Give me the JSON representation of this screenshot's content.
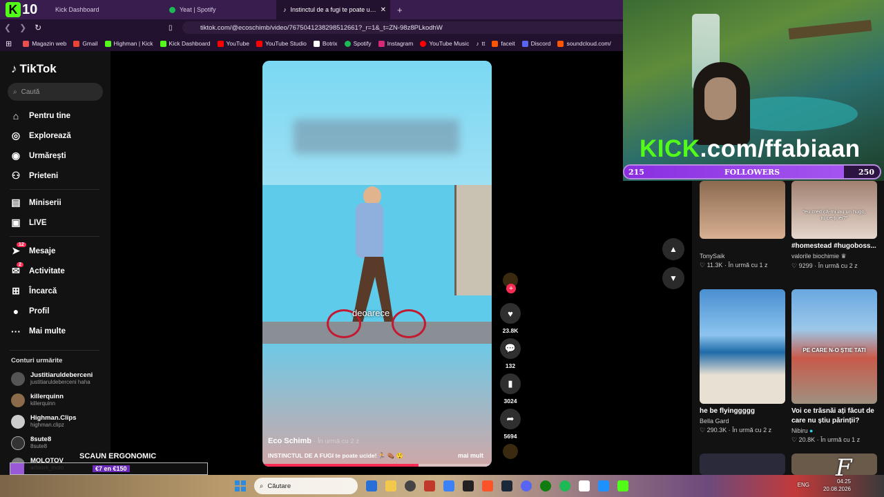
{
  "browser": {
    "tabs": [
      {
        "label": "Kick Dashboard",
        "icon": "kick-icon",
        "active": false
      },
      {
        "label": "Yeat | Spotify",
        "icon": "spotify-icon",
        "active": false
      },
      {
        "label": "Instinctul de a fugi te poate u…",
        "icon": "tiktok-icon",
        "active": true
      }
    ],
    "url": "tiktok.com/@ecoschimb/video/7675041238298512661?_r=1&_t=ZN-98z8PLkodhW",
    "bookmarks": [
      {
        "label": "Magazin web",
        "color": "#e94f4f"
      },
      {
        "label": "Gmail",
        "color": "#ea4335"
      },
      {
        "label": "Highman | Kick",
        "color": "#53fc18"
      },
      {
        "label": "Kick Dashboard",
        "color": "#53fc18"
      },
      {
        "label": "YouTube",
        "color": "#ff0000"
      },
      {
        "label": "YouTube Studio",
        "color": "#ff0000"
      },
      {
        "label": "Botrix",
        "color": "#ffffff"
      },
      {
        "label": "Spotify",
        "color": "#1db954"
      },
      {
        "label": "Instagram",
        "color": "#d62976"
      },
      {
        "label": "YouTube Music",
        "color": "#ff0000"
      },
      {
        "label": "tt",
        "color": "#ffffff"
      },
      {
        "label": "faceit",
        "color": "#ff5500"
      },
      {
        "label": "Discord",
        "color": "#5865f2"
      },
      {
        "label": "soundcloud.com/",
        "color": "#ff5500"
      }
    ]
  },
  "kick_badge": {
    "number": "10"
  },
  "tiktok": {
    "logo": "TikTok",
    "search_placeholder": "Caută",
    "menu": [
      {
        "label": "Pentru tine",
        "icon": "home-icon"
      },
      {
        "label": "Explorează",
        "icon": "compass-icon"
      },
      {
        "label": "Urmărești",
        "icon": "following-icon"
      },
      {
        "label": "Prieteni",
        "icon": "friends-icon"
      },
      {
        "label": "Miniserii",
        "icon": "series-icon"
      },
      {
        "label": "LIVE",
        "icon": "live-icon"
      },
      {
        "label": "Mesaje",
        "icon": "messages-icon",
        "badge": "12"
      },
      {
        "label": "Activitate",
        "icon": "activity-icon",
        "badge": "2"
      },
      {
        "label": "Încarcă",
        "icon": "upload-icon"
      },
      {
        "label": "Profil",
        "icon": "profile-icon"
      },
      {
        "label": "Mai multe",
        "icon": "more-icon"
      }
    ],
    "following_title": "Conturi urmărite",
    "following": [
      {
        "name": "Justitiaruldeberceni",
        "user": "justitiaruldeberceni haha"
      },
      {
        "name": "killerquinn",
        "user": "killerquinn"
      },
      {
        "name": "Highman.Clips",
        "user": "highman.clipz"
      },
      {
        "name": "8sute8",
        "user": "8sute8"
      },
      {
        "name": "MOLOTOV",
        "user": "artwork_molo"
      }
    ]
  },
  "video": {
    "caption": "deoarece",
    "author": "Eco Schimb",
    "time": "· În urmă cu 2 z",
    "description": "INSTINCTUL DE A FUGI te poate ucide! 🏃 ⚰️ 😲",
    "more": "mai mult",
    "progress": 0.68,
    "likes": "23.8K",
    "comments": "132",
    "saves": "3024",
    "shares": "5694"
  },
  "recommended": [
    {
      "title": "",
      "author": "TonySaik",
      "likes": "11.3K",
      "time": "În urmă cu 1 z",
      "overlay": ""
    },
    {
      "title": "#homestead #hugoboss...",
      "author": "valorile biochimie ♛",
      "likes": "9299",
      "time": "În urmă cu 2 z",
      "overlay": "\"eu cred că-mi iau un hugo, tu ce-ți iei?\""
    },
    {
      "title": "he be flyinggggg",
      "author": "Bella Gard",
      "likes": "290.3K",
      "time": "În urmă cu 2 z",
      "overlay": ""
    },
    {
      "title": "Voi ce trăsnăi ați făcut de care nu știu părinții?",
      "author": "Nibiru",
      "likes": "20.8K",
      "time": "În urmă cu 1 z",
      "overlay": "PE CARE N-O ȘTIE TATI"
    }
  ],
  "stream": {
    "kick_text_1": "KICK",
    "kick_text_2": ".com/ffabiaan",
    "followers_label": "FOLLOWERS",
    "followers_current": "215",
    "followers_goal": "250",
    "followers_progress": 0.86
  },
  "ad": {
    "title": "SCAUN ERGONOMIC",
    "price": "€7 en €150"
  },
  "taskbar": {
    "search": "Căutare",
    "lang": "ENG",
    "time": "04:25",
    "date": "20.08.2026"
  },
  "signature": "F"
}
